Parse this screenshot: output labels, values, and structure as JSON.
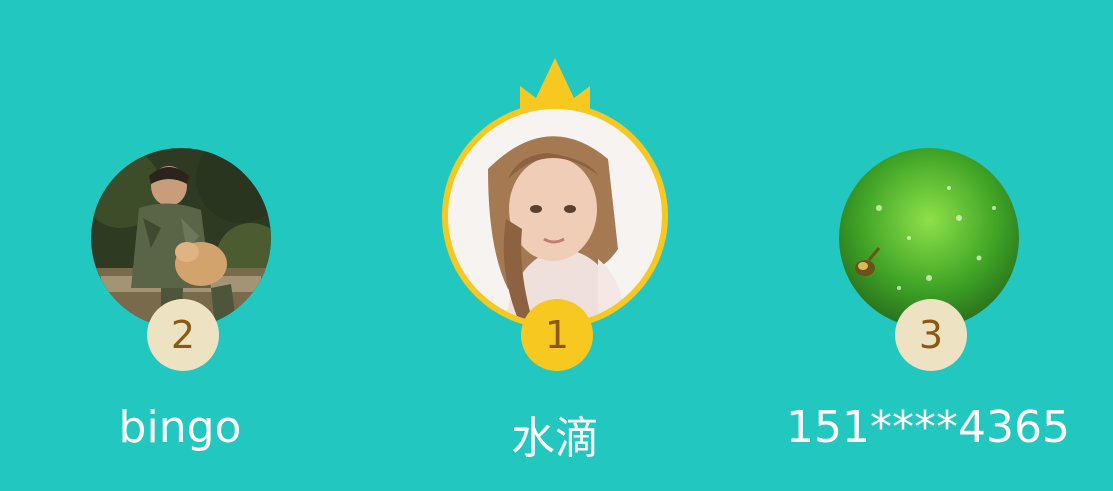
{
  "leaderboard": [
    {
      "rank": "2",
      "name": "bingo"
    },
    {
      "rank": "1",
      "name": "水滴"
    },
    {
      "rank": "3",
      "name": "151****4365"
    }
  ],
  "colors": {
    "background": "#22c8c0",
    "gold": "#f7c820",
    "badge_silver": "#ede3c3",
    "badge_text": "#8a5a12",
    "name_text": "#ffffff"
  },
  "icons": {
    "first_place": "crown-icon"
  }
}
